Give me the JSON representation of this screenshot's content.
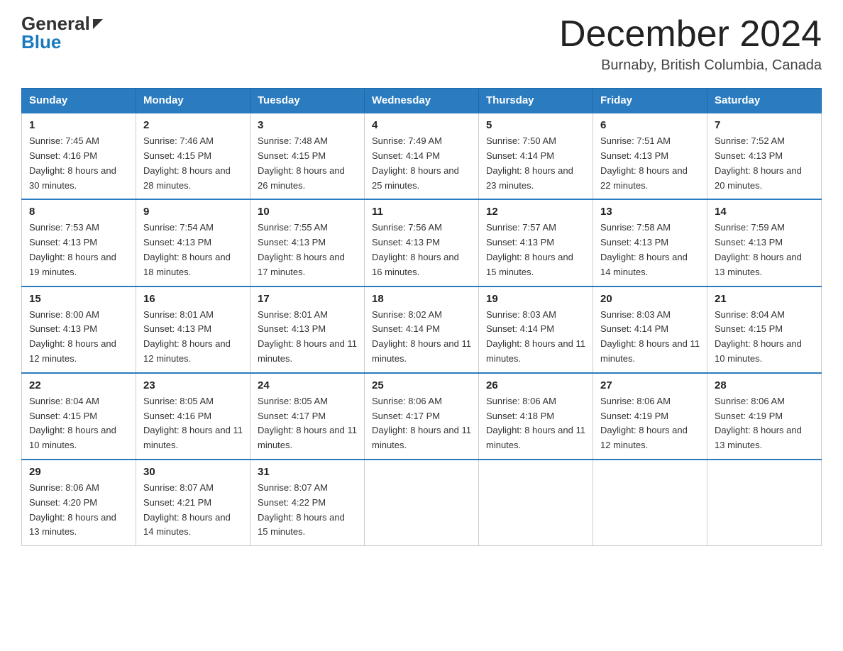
{
  "header": {
    "logo_general": "General",
    "logo_blue": "Blue",
    "month_title": "December 2024",
    "location": "Burnaby, British Columbia, Canada"
  },
  "weekdays": [
    "Sunday",
    "Monday",
    "Tuesday",
    "Wednesday",
    "Thursday",
    "Friday",
    "Saturday"
  ],
  "weeks": [
    [
      {
        "day": "1",
        "sunrise": "7:45 AM",
        "sunset": "4:16 PM",
        "daylight": "8 hours and 30 minutes."
      },
      {
        "day": "2",
        "sunrise": "7:46 AM",
        "sunset": "4:15 PM",
        "daylight": "8 hours and 28 minutes."
      },
      {
        "day": "3",
        "sunrise": "7:48 AM",
        "sunset": "4:15 PM",
        "daylight": "8 hours and 26 minutes."
      },
      {
        "day": "4",
        "sunrise": "7:49 AM",
        "sunset": "4:14 PM",
        "daylight": "8 hours and 25 minutes."
      },
      {
        "day": "5",
        "sunrise": "7:50 AM",
        "sunset": "4:14 PM",
        "daylight": "8 hours and 23 minutes."
      },
      {
        "day": "6",
        "sunrise": "7:51 AM",
        "sunset": "4:13 PM",
        "daylight": "8 hours and 22 minutes."
      },
      {
        "day": "7",
        "sunrise": "7:52 AM",
        "sunset": "4:13 PM",
        "daylight": "8 hours and 20 minutes."
      }
    ],
    [
      {
        "day": "8",
        "sunrise": "7:53 AM",
        "sunset": "4:13 PM",
        "daylight": "8 hours and 19 minutes."
      },
      {
        "day": "9",
        "sunrise": "7:54 AM",
        "sunset": "4:13 PM",
        "daylight": "8 hours and 18 minutes."
      },
      {
        "day": "10",
        "sunrise": "7:55 AM",
        "sunset": "4:13 PM",
        "daylight": "8 hours and 17 minutes."
      },
      {
        "day": "11",
        "sunrise": "7:56 AM",
        "sunset": "4:13 PM",
        "daylight": "8 hours and 16 minutes."
      },
      {
        "day": "12",
        "sunrise": "7:57 AM",
        "sunset": "4:13 PM",
        "daylight": "8 hours and 15 minutes."
      },
      {
        "day": "13",
        "sunrise": "7:58 AM",
        "sunset": "4:13 PM",
        "daylight": "8 hours and 14 minutes."
      },
      {
        "day": "14",
        "sunrise": "7:59 AM",
        "sunset": "4:13 PM",
        "daylight": "8 hours and 13 minutes."
      }
    ],
    [
      {
        "day": "15",
        "sunrise": "8:00 AM",
        "sunset": "4:13 PM",
        "daylight": "8 hours and 12 minutes."
      },
      {
        "day": "16",
        "sunrise": "8:01 AM",
        "sunset": "4:13 PM",
        "daylight": "8 hours and 12 minutes."
      },
      {
        "day": "17",
        "sunrise": "8:01 AM",
        "sunset": "4:13 PM",
        "daylight": "8 hours and 11 minutes."
      },
      {
        "day": "18",
        "sunrise": "8:02 AM",
        "sunset": "4:14 PM",
        "daylight": "8 hours and 11 minutes."
      },
      {
        "day": "19",
        "sunrise": "8:03 AM",
        "sunset": "4:14 PM",
        "daylight": "8 hours and 11 minutes."
      },
      {
        "day": "20",
        "sunrise": "8:03 AM",
        "sunset": "4:14 PM",
        "daylight": "8 hours and 11 minutes."
      },
      {
        "day": "21",
        "sunrise": "8:04 AM",
        "sunset": "4:15 PM",
        "daylight": "8 hours and 10 minutes."
      }
    ],
    [
      {
        "day": "22",
        "sunrise": "8:04 AM",
        "sunset": "4:15 PM",
        "daylight": "8 hours and 10 minutes."
      },
      {
        "day": "23",
        "sunrise": "8:05 AM",
        "sunset": "4:16 PM",
        "daylight": "8 hours and 11 minutes."
      },
      {
        "day": "24",
        "sunrise": "8:05 AM",
        "sunset": "4:17 PM",
        "daylight": "8 hours and 11 minutes."
      },
      {
        "day": "25",
        "sunrise": "8:06 AM",
        "sunset": "4:17 PM",
        "daylight": "8 hours and 11 minutes."
      },
      {
        "day": "26",
        "sunrise": "8:06 AM",
        "sunset": "4:18 PM",
        "daylight": "8 hours and 11 minutes."
      },
      {
        "day": "27",
        "sunrise": "8:06 AM",
        "sunset": "4:19 PM",
        "daylight": "8 hours and 12 minutes."
      },
      {
        "day": "28",
        "sunrise": "8:06 AM",
        "sunset": "4:19 PM",
        "daylight": "8 hours and 13 minutes."
      }
    ],
    [
      {
        "day": "29",
        "sunrise": "8:06 AM",
        "sunset": "4:20 PM",
        "daylight": "8 hours and 13 minutes."
      },
      {
        "day": "30",
        "sunrise": "8:07 AM",
        "sunset": "4:21 PM",
        "daylight": "8 hours and 14 minutes."
      },
      {
        "day": "31",
        "sunrise": "8:07 AM",
        "sunset": "4:22 PM",
        "daylight": "8 hours and 15 minutes."
      },
      null,
      null,
      null,
      null
    ]
  ],
  "labels": {
    "sunrise": "Sunrise:",
    "sunset": "Sunset:",
    "daylight": "Daylight:"
  }
}
